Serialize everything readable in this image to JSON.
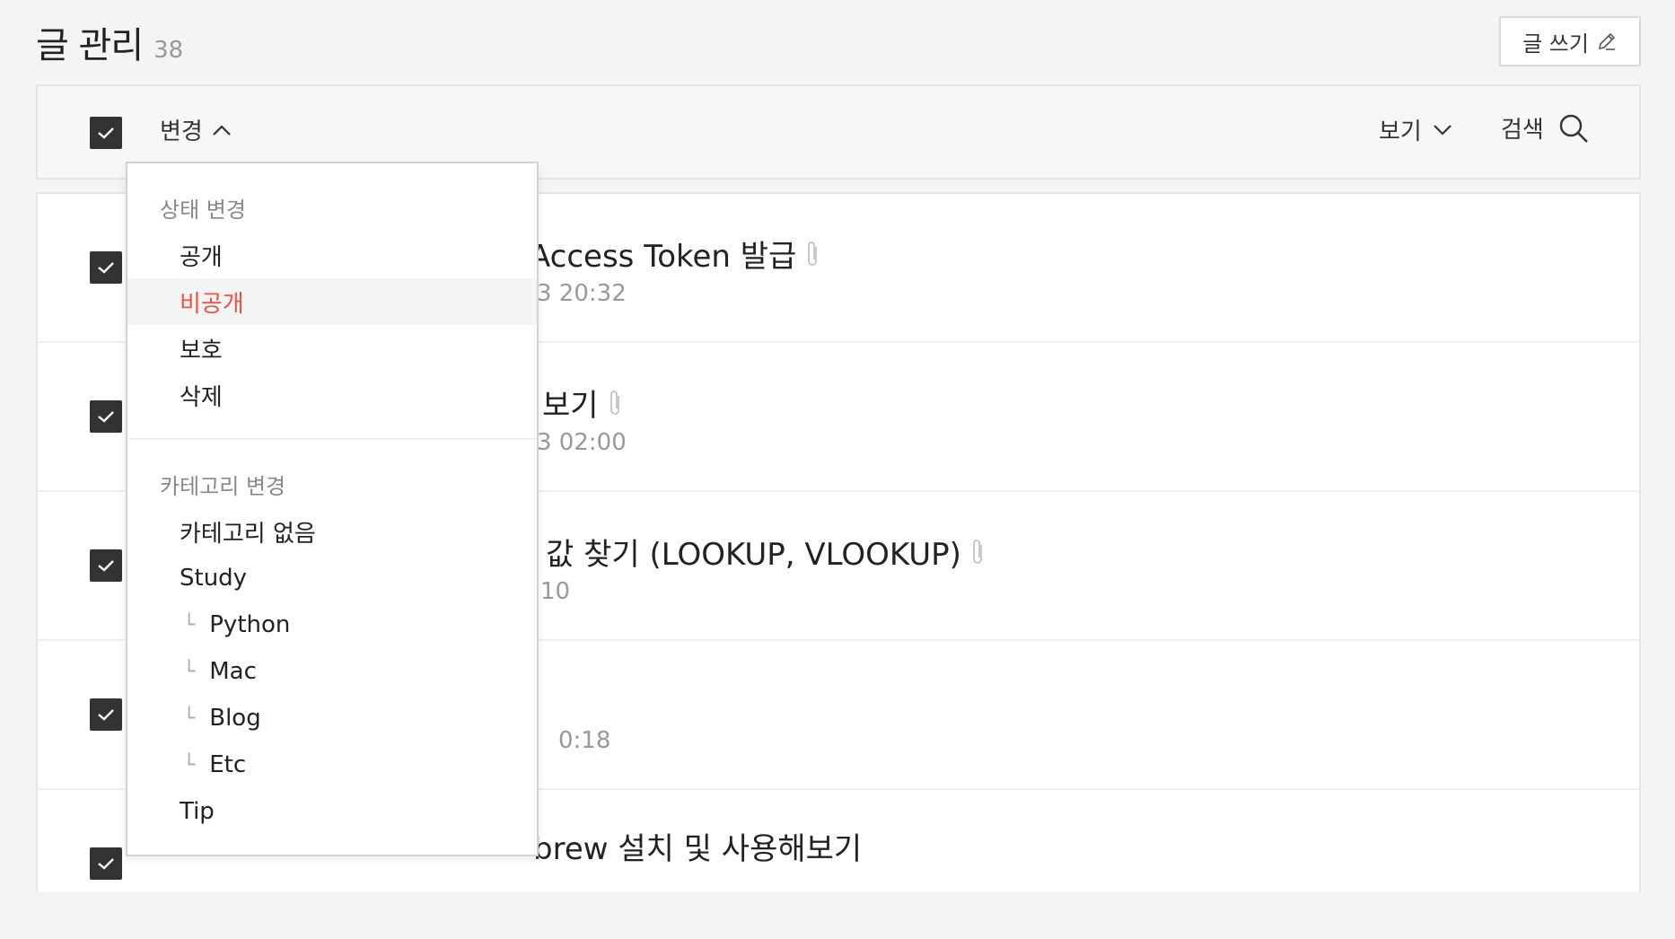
{
  "header": {
    "title": "글 관리",
    "count": "38",
    "write_label": "글 쓰기"
  },
  "toolbar": {
    "change_label": "변경",
    "view_label": "보기",
    "search_label": "검색"
  },
  "dropdown": {
    "status_section": "상태 변경",
    "status_items": [
      "공개",
      "비공개",
      "보호",
      "삭제"
    ],
    "active_item": "비공개",
    "category_section": "카테고리 변경",
    "category_items": [
      {
        "label": "카테고리 없음",
        "sub": false
      },
      {
        "label": "Study",
        "sub": false
      },
      {
        "label": "Python",
        "sub": true
      },
      {
        "label": "Mac",
        "sub": true
      },
      {
        "label": "Blog",
        "sub": true
      },
      {
        "label": "Etc",
        "sub": true
      },
      {
        "label": "Tip",
        "sub": false
      }
    ],
    "sub_marker": "└"
  },
  "rows": [
    {
      "title": "Access Token 발급",
      "date": "3 20:32",
      "attachment": true
    },
    {
      "title": "보기",
      "date": "3 02:00",
      "attachment": true
    },
    {
      "title": "값 찾기 (LOOKUP, VLOOKUP)",
      "date": "10",
      "attachment": true
    },
    {
      "title": "",
      "date": "0:18",
      "attachment": false
    },
    {
      "title": "brew 설치 및 사용해보기",
      "date": "",
      "attachment": false
    }
  ],
  "colors": {
    "accent": "#f0533b",
    "checkbox": "#333333"
  }
}
